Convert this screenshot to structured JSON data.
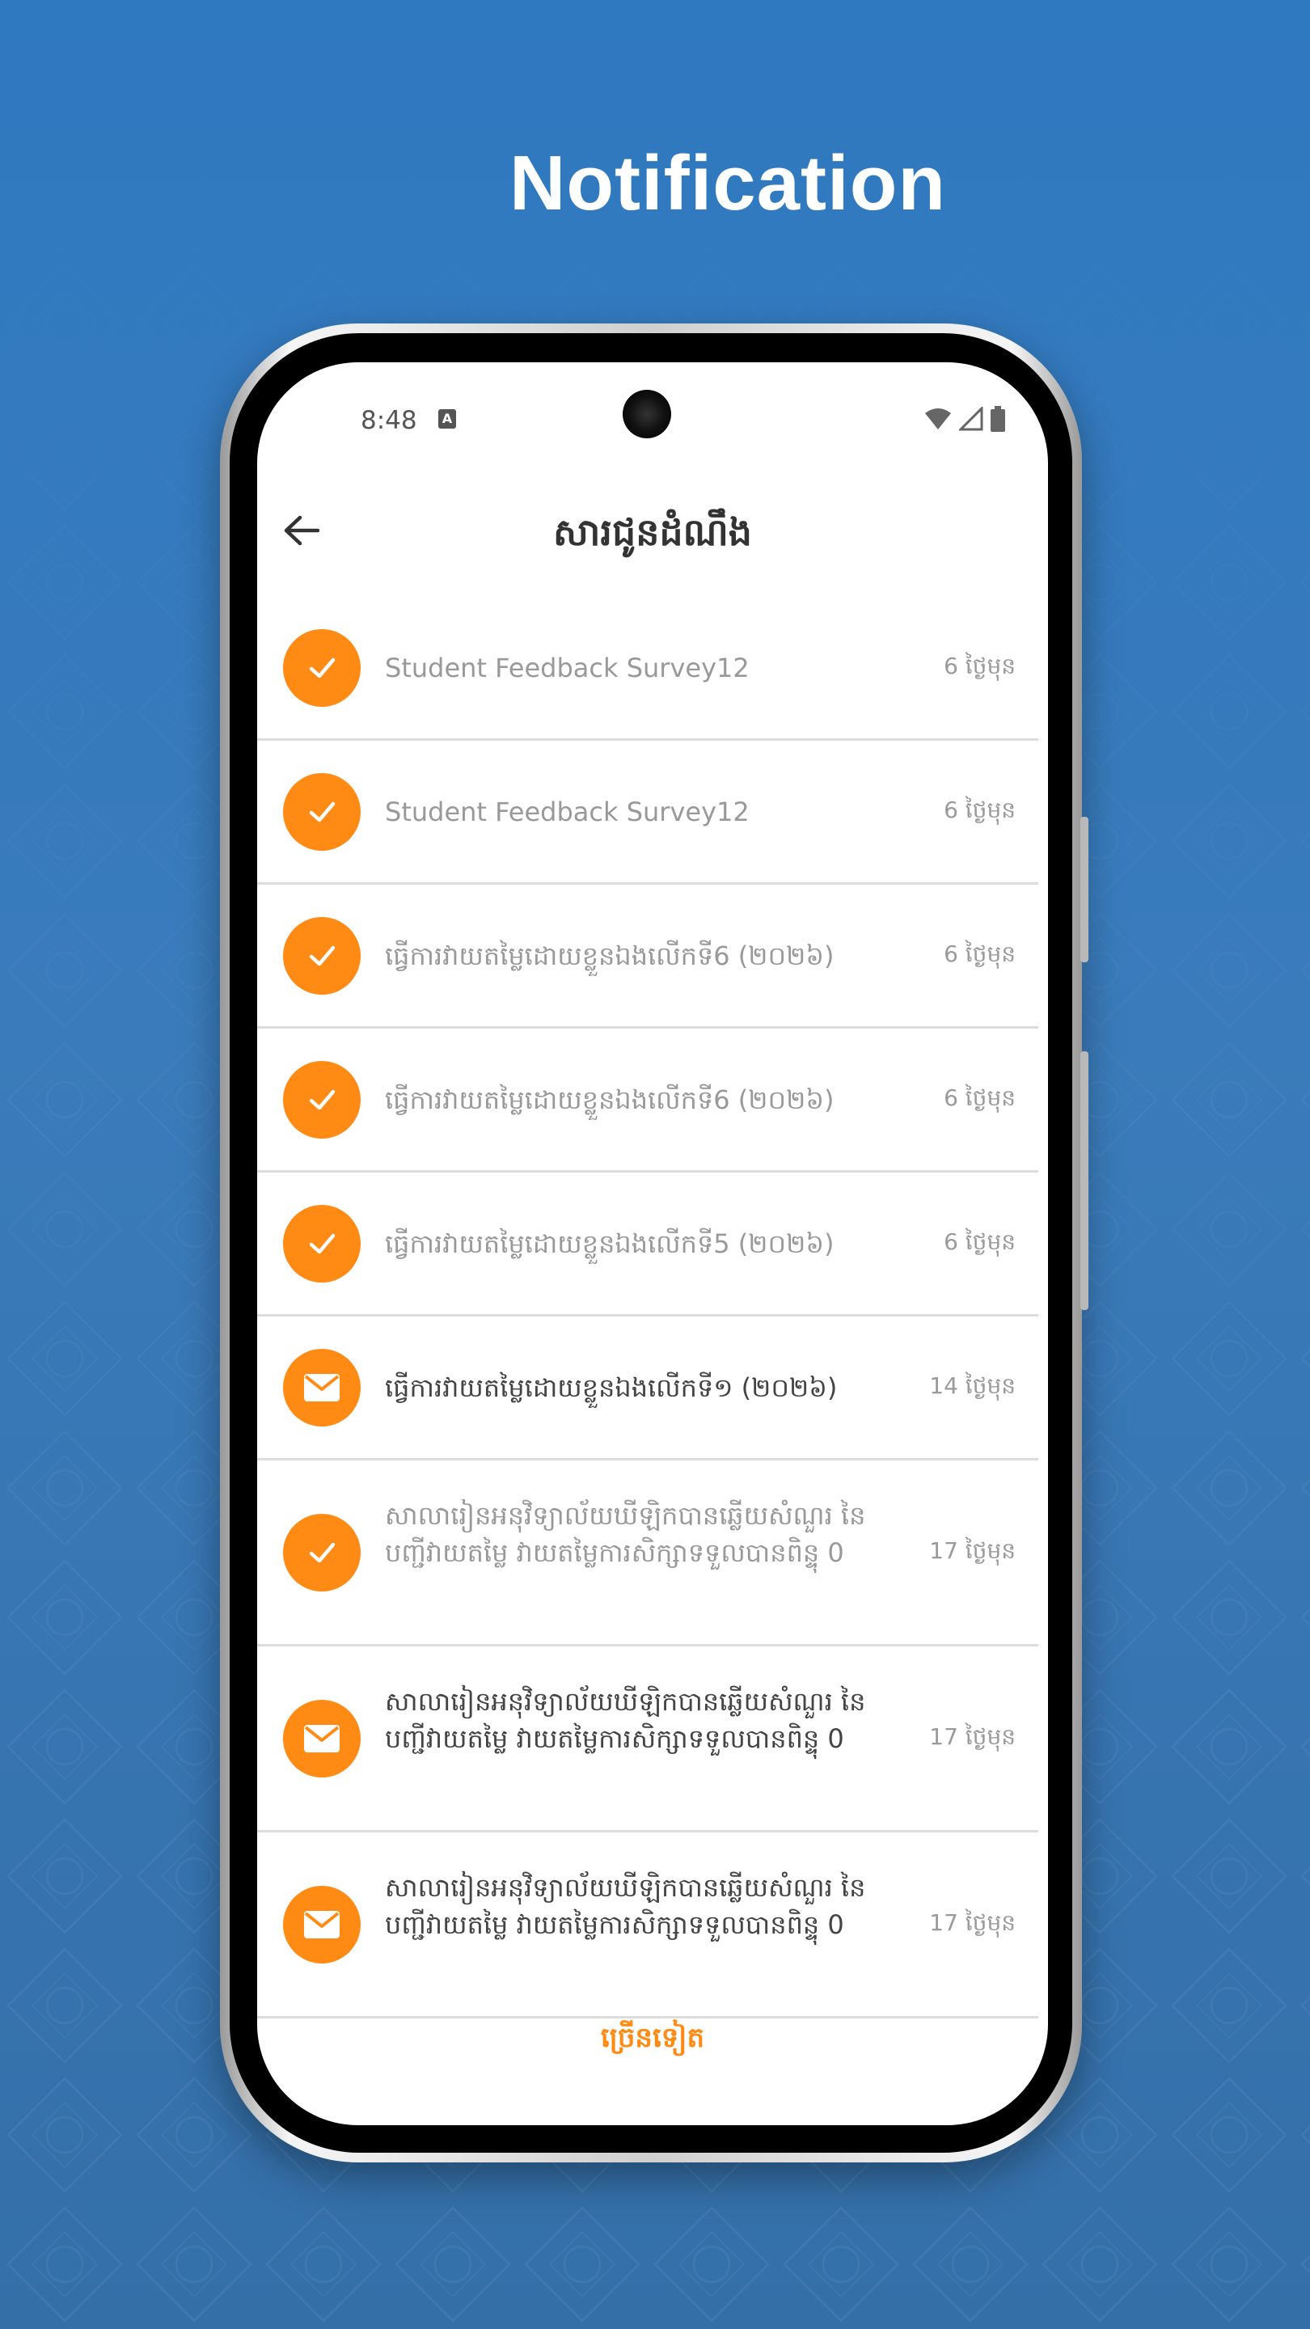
{
  "headline": "Notification",
  "colors": {
    "accent": "#ff8a14",
    "background": "#2f79c0"
  },
  "status_bar": {
    "time": "8:48",
    "badge_icon": "a-icon",
    "icons": [
      "wifi-icon",
      "signal-icon",
      "battery-icon"
    ]
  },
  "app_bar": {
    "title": "សារជូនដំណឹង",
    "back_icon": "arrow-left-icon"
  },
  "notifications": [
    {
      "icon": "check-icon",
      "text": "Student Feedback Survey12",
      "time": "6 ថ្ងៃមុន",
      "read": true
    },
    {
      "icon": "check-icon",
      "text": "Student Feedback Survey12",
      "time": "6 ថ្ងៃមុន",
      "read": true
    },
    {
      "icon": "check-icon",
      "text": "ធ្វើការវាយតម្លៃដោយខ្លួនឯងលើកទី6 (២០២៦)",
      "time": "6 ថ្ងៃមុន",
      "read": true
    },
    {
      "icon": "check-icon",
      "text": "ធ្វើការវាយតម្លៃដោយខ្លួនឯងលើកទី6 (២០២៦)",
      "time": "6 ថ្ងៃមុន",
      "read": true
    },
    {
      "icon": "check-icon",
      "text": "ធ្វើការវាយតម្លៃដោយខ្លួនឯងលើកទី5 (២០២៦)",
      "time": "6 ថ្ងៃមុន",
      "read": true
    },
    {
      "icon": "mail-icon",
      "text": "ធ្វើការវាយតម្លៃដោយខ្លួនឯងលើកទី១ (២០២៦)",
      "time": "14 ថ្ងៃមុន",
      "read": false
    },
    {
      "icon": "check-icon",
      "text": "សាលារៀនអនុវិទ្យាល័យឃីឡិកបានឆ្លើយសំណួរ នៃបញ្ជីវាយតម្លៃ វាយតម្លៃការសិក្សាទទួលបានពិន្ទុ 0",
      "time": "17 ថ្ងៃមុន",
      "read": true
    },
    {
      "icon": "mail-icon",
      "text": "សាលារៀនអនុវិទ្យាល័យឃីឡិកបានឆ្លើយសំណួរ នៃបញ្ជីវាយតម្លៃ វាយតម្លៃការសិក្សាទទួលបានពិន្ទុ 0",
      "time": "17 ថ្ងៃមុន",
      "read": false
    },
    {
      "icon": "mail-icon",
      "text": "សាលារៀនអនុវិទ្យាល័យឃីឡិកបានឆ្លើយសំណួរ នៃបញ្ជីវាយតម្លៃ វាយតម្លៃការសិក្សាទទួលបានពិន្ទុ 0",
      "time": "17 ថ្ងៃមុន",
      "read": false
    }
  ],
  "more_label": "ច្រើនទៀត"
}
